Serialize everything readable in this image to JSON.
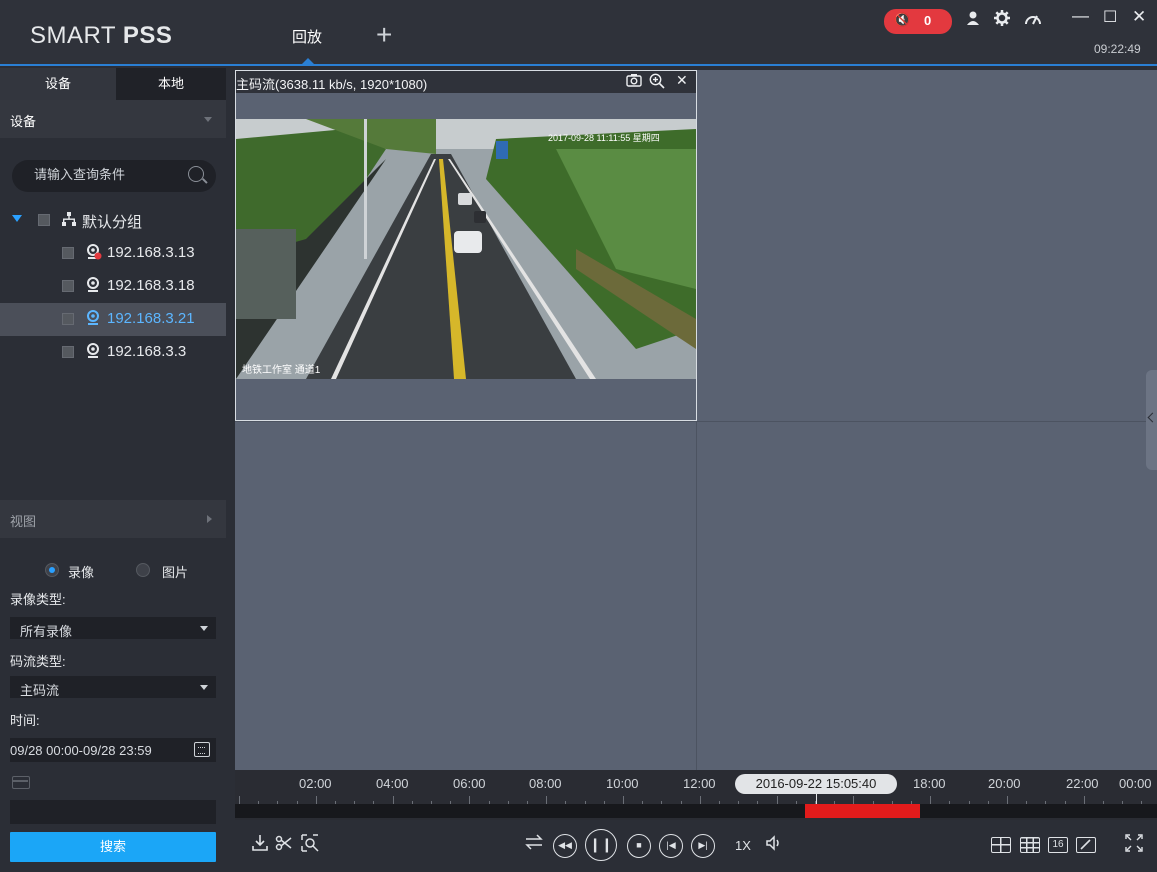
{
  "app": {
    "name_light": "SMART ",
    "name_bold": "PSS",
    "tab_label": "回放",
    "add_tab": "+"
  },
  "topbar": {
    "alarm_mute": "🔇",
    "alarm_count": "0",
    "user_icon": "user-icon",
    "settings_icon": "gear-icon",
    "performance_icon": "speedometer-icon",
    "minimize": "—",
    "maximize": "☐",
    "close": "✕",
    "time": "09:22:49"
  },
  "sidebar": {
    "tabs": [
      "设备",
      "本地"
    ],
    "section_device": "设备",
    "search_placeholder": "请输入查询条件",
    "tree_root": "默认分组",
    "devices": [
      "192.168.3.13",
      "192.168.3.18",
      "192.168.3.21",
      "192.168.3.3"
    ],
    "selected_device": "192.168.3.21",
    "section_view": "视图",
    "mode_options": [
      "录像",
      "图片"
    ],
    "selected_mode": "录像",
    "record_type_label": "录像类型:",
    "record_type_value": "所有录像",
    "stream_type_label": "码流类型:",
    "stream_type_value": "主码流",
    "time_label": "时间:",
    "time_value": "09/28 00:00-09/28 23:59",
    "search_button": "搜索"
  },
  "player": {
    "stream_info": "主码流(3638.11 kb/s, 1920*1080)",
    "video_timestamp": "2017-09-28 11:11:55 星期四",
    "video_caption": "地铁工作室 通道1"
  },
  "timeline": {
    "labels": [
      "02:00",
      "04:00",
      "06:00",
      "08:00",
      "10:00",
      "12:00",
      "18:00",
      "20:00",
      "22:00",
      "00:00"
    ],
    "cursor": "2016-09-22 15:05:40"
  },
  "controls": {
    "speed": "1X",
    "layout_16": "16"
  },
  "colors": {
    "accent": "#2a7fd4",
    "alarm": "#e3393f",
    "search_button": "#1ba6f7",
    "records": "#e21b1b"
  }
}
